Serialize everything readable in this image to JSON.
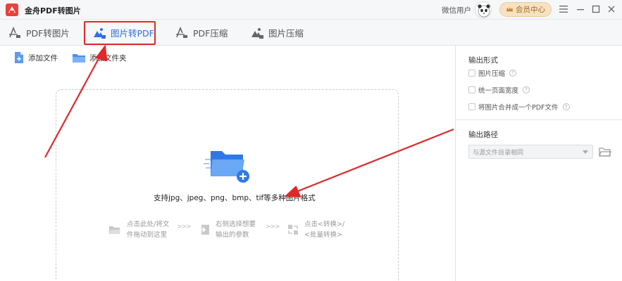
{
  "app": {
    "title": "金舟PDF转图片",
    "wechat_user": "微信用户",
    "member_label": "会员中心"
  },
  "tabs": [
    {
      "label": "PDF转图片",
      "icon": "pdf-to-image-icon"
    },
    {
      "label": "图片转PDF",
      "icon": "image-to-pdf-icon",
      "active": true
    },
    {
      "label": "PDF压缩",
      "icon": "pdf-compress-icon"
    },
    {
      "label": "图片压缩",
      "icon": "image-compress-icon"
    }
  ],
  "toolbar": {
    "add_file": "添加文件",
    "add_folder": "添加文件夹"
  },
  "dropzone": {
    "formats": "支持jpg、jpeg、png、bmp、tif等多种图片格式",
    "steps": [
      {
        "line1": "点击此处/将文",
        "line2": "件拖动到这里",
        "icon": "folder-open-icon"
      },
      {
        "line1": "右侧选择想要",
        "line2": "输出的参数",
        "icon": "import-icon"
      },
      {
        "line1": "点击<转换>/",
        "line2": "<批量转换>",
        "icon": "convert-icon"
      }
    ],
    "separator": ">>>"
  },
  "output": {
    "format_title": "输出形式",
    "options": [
      {
        "label": "图片压缩",
        "checked": false
      },
      {
        "label": "统一页面宽度",
        "checked": false
      },
      {
        "label": "将图片合并成一个PDF文件",
        "checked": false
      }
    ],
    "path_title": "输出路径",
    "path_value": "与源文件目录相同"
  },
  "colors": {
    "accent": "#2f6fe4",
    "annotation_red": "#e0282a",
    "member_gold": "#a36a1f"
  }
}
